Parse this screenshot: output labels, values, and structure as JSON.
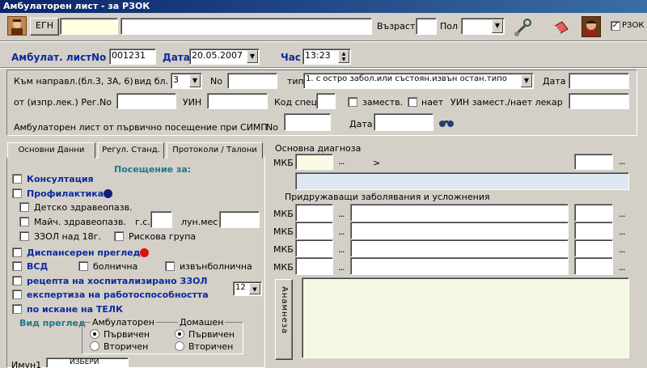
{
  "window": {
    "title": "Амбулаторен лист - за РЗОК"
  },
  "patient": {
    "egn_label": "ЕГН",
    "age_label": "Възраст",
    "gender_label": "Пол",
    "rzok_label": "РЗОК"
  },
  "sheet": {
    "label": "Амбулат. лист",
    "no_label": "No",
    "number": "001231",
    "date_label": "Дата",
    "date": "20.05.2007",
    "time_label": "Час",
    "time": "13:23"
  },
  "referral": {
    "label": "Към направл.(бл.3, 3А, 6)",
    "form_type_label": "вид бл.",
    "form_type": "3",
    "no_label": "No",
    "type_label": "тип",
    "type_value": "1. с остро забол.или състоян.извън остан.типо",
    "date_label": "Дата",
    "from_label": "от (изпр.лек.) Рег.No",
    "uin_label": "УИН",
    "spec_code_label": "Код спец",
    "substitute_label": "заместв.",
    "hired_label": "нает",
    "sub_uin_label": "УИН замест./нает лекар",
    "simp_label": "Амбулаторен лист от първично посещение при СИМП",
    "simp_no_label": "No",
    "simp_date_label": "Дата"
  },
  "tabs": [
    "Основни Данни",
    "Регул. Станд.",
    "Протоколи / Талони"
  ],
  "visit": {
    "header": "Посещение за:",
    "consultation": "Консултация",
    "prophylaxis": "Профилактика",
    "child_health": "Детско здравеопазв.",
    "maternal_health": "Майч. здравеопазв.",
    "gs_label": "г.с.",
    "lun_label": "лун.мес",
    "zzol": "ЗЗОЛ над 18г.",
    "risk_group": "Рискова група",
    "dispensary": "Диспансерен преглед",
    "vsd": "ВСД",
    "in_hospital": "болнична",
    "out_hospital": "извънболнична",
    "prescription": "рецепта на хоспитализирано ЗЗОЛ",
    "expertise": "експертиза на работоспособността",
    "expertise_value": "12",
    "telk": "по искане на ТЕЛК",
    "exam_type_label": "Вид преглед",
    "ambulatory_label": "Амбулаторен",
    "home_label": "Домашен",
    "primary": "Първичен",
    "secondary": "Вторичен",
    "immun_label": "Имун1",
    "immun_value": "ИЗБЕРИ"
  },
  "diagnosis": {
    "main_label": "Основна диагноза",
    "mkb_label": "МКБ",
    "dots": "...",
    "gt": ">",
    "related_label": "Придружаващи заболявания и усложнения",
    "anamnesis_label": "Анамнеза"
  },
  "colors": {
    "title_bar_start": "#0a246a",
    "title_bar_end": "#3a6ea5",
    "prophylaxis_dot": "#0d1f7a",
    "dispensary_dot": "#e01010",
    "label_blue": "#0b2a9e",
    "header_teal": "#1a7a8a"
  }
}
